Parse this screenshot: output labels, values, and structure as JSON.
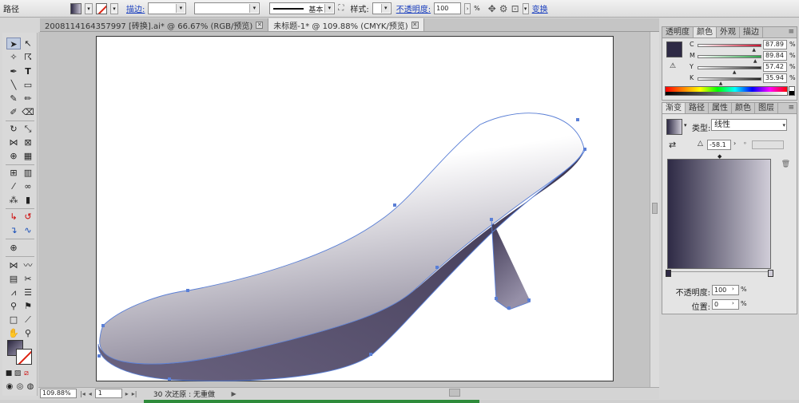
{
  "control_bar": {
    "object_type": "路径",
    "stroke_label": "描边:",
    "stroke_style": "基本",
    "style_label": "样式:",
    "opacity_label": "不透明度:",
    "opacity_value": "100",
    "opacity_unit": "%",
    "transform_label": "变换"
  },
  "tabs": [
    {
      "label": "2008114164357997 [砖换].ai* @ 66.67% (RGB/预览)",
      "active": false
    },
    {
      "label": "未标题-1* @ 109.88% (CMYK/预览)",
      "active": true
    }
  ],
  "status": {
    "zoom": "109.88%",
    "page": "1",
    "message": "30 次还原 : 无重做"
  },
  "color_panel": {
    "tabs": [
      "透明度",
      "颜色",
      "外观",
      "描边"
    ],
    "active_tab": 1,
    "swatch_color": "#2e2a45",
    "channels": [
      {
        "name": "C",
        "value": "87.89",
        "fraction": 0.879,
        "color": "#c8102e"
      },
      {
        "name": "M",
        "value": "89.84",
        "fraction": 0.898,
        "color": "#2ba84a"
      },
      {
        "name": "Y",
        "value": "57.42",
        "fraction": 0.574,
        "color": "#2d2d2d"
      },
      {
        "name": "K",
        "value": "35.94",
        "fraction": 0.359,
        "color": "#202020"
      }
    ],
    "unit": "%"
  },
  "gradient_panel": {
    "tabs": [
      "渐变",
      "路径",
      "属性",
      "颜色",
      "图层"
    ],
    "active_tab": 0,
    "type_label": "类型:",
    "type_value": "线性",
    "angle_value": "-58.1",
    "opacity_label": "不透明度:",
    "opacity_value": "100",
    "location_label": "位置:",
    "location_value": "0",
    "unit": "%",
    "start_color": "#2e2a45",
    "end_color": "#d0cdd8"
  },
  "colors": {
    "shoe_dark": "#3b3450",
    "shoe_light": "#ffffff",
    "path_blue": "#5a7fd6"
  }
}
